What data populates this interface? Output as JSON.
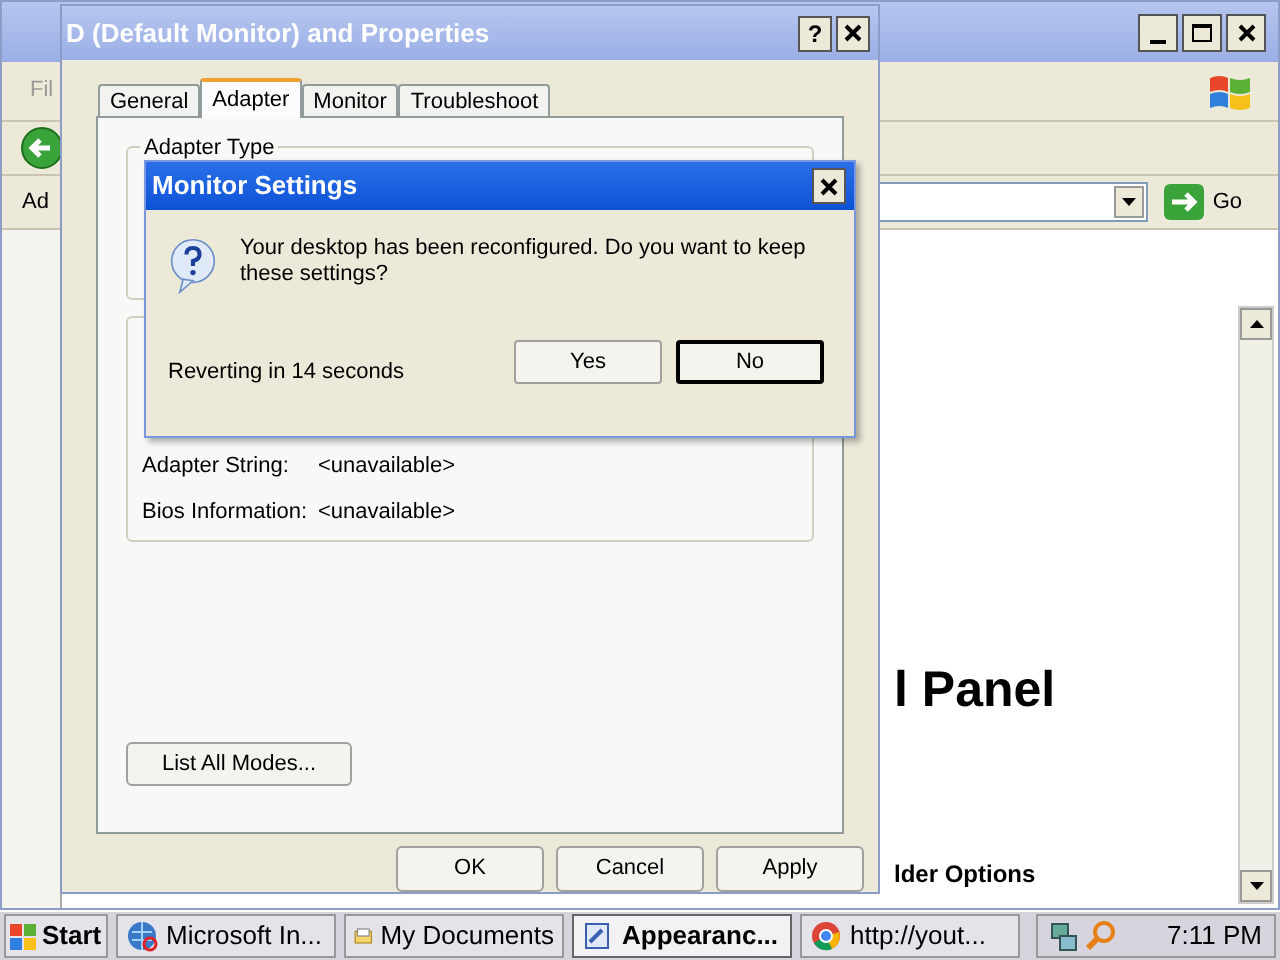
{
  "explorer_window": {
    "menu_item": "Fil",
    "address_label": "Ad",
    "go_button": "Go",
    "heading": "l Panel",
    "link": "lder Options"
  },
  "properties_dialog": {
    "title": "D (Default Monitor) and  Properties",
    "help_button": "?",
    "tabs": [
      {
        "label": "General",
        "selected": false
      },
      {
        "label": "Adapter",
        "selected": true
      },
      {
        "label": "Monitor",
        "selected": false
      },
      {
        "label": "Troubleshoot",
        "selected": false
      }
    ],
    "adapter_type_group": "Adapter Type",
    "info_rows": [
      {
        "label": "Adapter String:",
        "value": "<unavailable>"
      },
      {
        "label": "Bios Information:",
        "value": "<unavailable>"
      }
    ],
    "list_modes_button": "List All Modes...",
    "buttons": [
      "OK",
      "Cancel",
      "Apply"
    ]
  },
  "monitor_settings_dialog": {
    "title": "Monitor Settings",
    "message": "Your desktop has been reconfigured.  Do you want to keep these settings?",
    "countdown": "Reverting in 14 seconds",
    "buttons": [
      {
        "label": "Yes",
        "default": false
      },
      {
        "label": "No",
        "default": true
      }
    ]
  },
  "taskbar": {
    "start": "Start",
    "items": [
      {
        "label": "Microsoft In...",
        "selected": false,
        "kind": "browser"
      },
      {
        "label": "My Documents",
        "selected": false,
        "kind": "folder"
      },
      {
        "label": "Appearanc...",
        "selected": true,
        "kind": "display"
      },
      {
        "label": "http://yout...",
        "selected": false,
        "kind": "chrome"
      }
    ],
    "clock": "7:11 PM"
  }
}
